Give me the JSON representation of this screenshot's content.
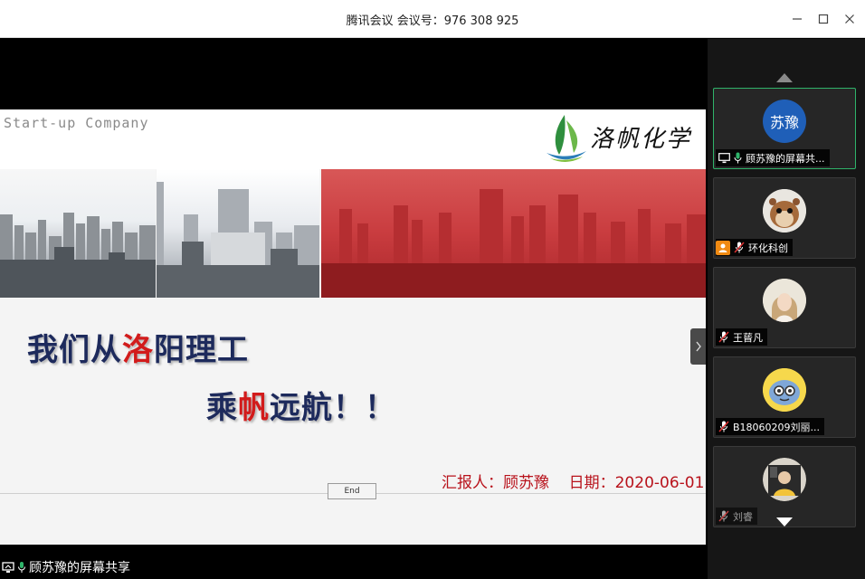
{
  "window": {
    "title": "腾讯会议  会议号：976 308 925"
  },
  "slide": {
    "header_text": "Start-up Company",
    "logo_text": "洛帆化学",
    "slogan_line1": {
      "before": "我们从",
      "highlight": "洛",
      "after": "阳理工"
    },
    "slogan_line2": {
      "before": "乘",
      "highlight": "帆",
      "after": "远航！！"
    },
    "reporter": "汇报人：顾苏豫    日期：2020-06-01",
    "end_button": "End"
  },
  "share_status": {
    "text": "顾苏豫的屏幕共享"
  },
  "participants": [
    {
      "name": "顾苏豫的屏幕共...",
      "avatar_text": "苏豫",
      "avatar_color": "#1f5fb8",
      "active": true
    },
    {
      "name": "环化科创",
      "avatar_text": "",
      "active": false
    },
    {
      "name": "王蒈凡",
      "avatar_text": "",
      "active": false
    },
    {
      "name": "B18060209刘丽...",
      "avatar_text": "",
      "active": false
    },
    {
      "name": "刘睿",
      "avatar_text": "",
      "active": false
    }
  ],
  "colors": {
    "accent_green": "#2fb36a",
    "slogan_blue": "#1d2a5c",
    "slogan_red": "#d21b1b",
    "reporter_red": "#b8121b"
  }
}
